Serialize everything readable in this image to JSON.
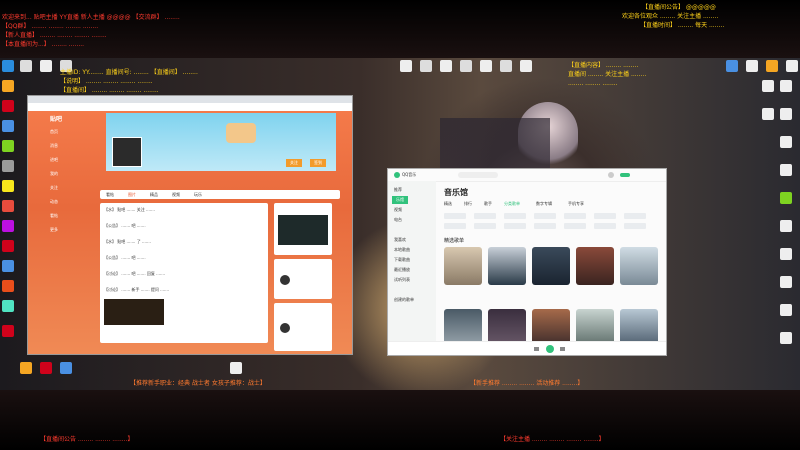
{
  "overlays": {
    "top_left_line1": "欢迎来到... 贴吧主播  YY直播  新人主播  @@@@  【交流群】  ........",
    "top_left_line2": "【QQ群】  ........  ........  ........  ........",
    "top_left_line3": "【新人直播】  ........  ........  ........  ........",
    "top_left_line4": "【本直播间为...】  ........  ........",
    "top_right_line1": "【直播间公告】 @@@@@",
    "top_right_line2": "欢迎各位观众 ........ 关注主播 ........",
    "top_right_line3": "【直播时间】 ........ 每天 ........",
    "mid_left_line1": "主播ID: YY........  直播间号: ........  【直播间】  ........",
    "mid_left_line2": "【说明】 ........  ........  ........  ........",
    "mid_left_line3": "【直播间】 ........  ........  ........  ........",
    "mid_right_line1": "【直播内容】 ........  ........",
    "mid_right_line2": "直播间 ........ 关注主播 ........",
    "mid_right_line3": "........  ........  ........",
    "bottom_left_banner": "【推荐新手职业：经典  战士者  女孩子推荐：战士】",
    "bottom_right_banner": "【新手推荐  ........  ........  活动推荐  ........】",
    "footer_left": "【直播间公告  ........  ........  ........】",
    "footer_right": "【关注主播  ........  ........  ........  ........】"
  },
  "browser": {
    "address": "tieba.baidu.com/f?kw=...",
    "site_logo": "贴吧",
    "nav_tabs": [
      "看帖",
      "图片",
      "精品",
      "视频",
      "玩乐"
    ],
    "sidebar_items": [
      "首页",
      "消息",
      "进吧",
      "我的",
      "关注",
      "动态",
      "看帖",
      "更多"
    ],
    "posts": [
      "【水】 贴吧 ....... 关注 .......",
      "【公告】 ....... 吧 .......",
      "【水】 贴吧 ....... 了 .......",
      "【公告】 ....... 吧 .......",
      "【讨论】 ....... 吧 ....... 回复 .......",
      "【讨论】 ....... 新手 ....... 提问 ......."
    ],
    "follow_label": "关注",
    "sign_label": "签到"
  },
  "music": {
    "title": "音乐馆",
    "sidebar_items": [
      "推荐",
      "乐馆",
      "视频",
      "电台",
      "我喜欢",
      "本地歌曲",
      "下载歌曲",
      "最近播放",
      "试听列表",
      "创建的歌单"
    ],
    "tabs": [
      "精选",
      "排行",
      "歌手",
      "分类歌单",
      "数字专辑",
      "手机专享"
    ],
    "section": "精选歌单",
    "player_label": "QQ音乐"
  },
  "colors": {
    "site_orange": "#f47a4a",
    "music_green": "#31c27c",
    "overlay_red": "#ff3b2f",
    "overlay_yellow": "#ffd21a"
  }
}
